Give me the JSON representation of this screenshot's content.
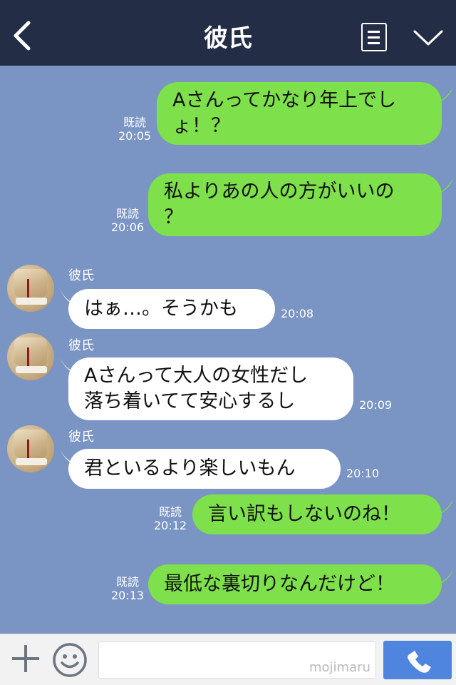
{
  "header": {
    "title": "彼氏"
  },
  "messages": [
    {
      "side": "me",
      "lines": [
        "Aさんってかなり年上でし",
        "ょ！？"
      ],
      "read": "既読",
      "time": "20:05"
    },
    {
      "side": "me",
      "lines": [
        "私よりあの人の方がいいの",
        "？"
      ],
      "read": "既読",
      "time": "20:06"
    },
    {
      "side": "them",
      "sender": "彼氏",
      "lines": [
        "はぁ…。そうかも"
      ],
      "time": "20:08"
    },
    {
      "side": "them",
      "sender": "彼氏",
      "lines": [
        "Aさんって大人の女性だし",
        "落ち着いてて安心するし"
      ],
      "time": "20:09"
    },
    {
      "side": "them",
      "sender": "彼氏",
      "lines": [
        "君といるより楽しいもん"
      ],
      "time": "20:10"
    },
    {
      "side": "me",
      "lines": [
        "言い訳もしないのね！"
      ],
      "read": "既読",
      "time": "20:12"
    },
    {
      "side": "me",
      "lines": [
        "最低な裏切りなんだけど！"
      ],
      "read": "既読",
      "time": "20:13"
    }
  ],
  "input": {
    "placeholder": ""
  },
  "watermark": "mojimaru",
  "icons": {
    "back": "chevron-left-icon",
    "menu": "list-menu-icon",
    "collapse": "chevron-down-icon",
    "add": "plus-icon",
    "emoji": "smiley-icon",
    "call": "phone-icon"
  },
  "colors": {
    "header": "#232d45",
    "chat_bg": "#7a95c4",
    "my_bubble": "#7ee04a",
    "their_bubble": "#ffffff",
    "call_button": "#4f84df"
  }
}
